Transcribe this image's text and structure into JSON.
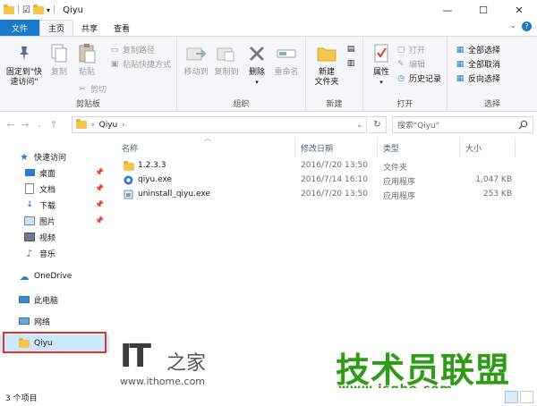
{
  "window": {
    "title": "Qiyu",
    "minimize": "—",
    "maximize": "☐",
    "close": "✕"
  },
  "tabs": [
    {
      "label": "文件"
    },
    {
      "label": "主页"
    },
    {
      "label": "共享"
    },
    {
      "label": "查看"
    }
  ],
  "ribbon": {
    "clipboard": {
      "label": "剪贴板",
      "pin": "固定到\"快\n速访问\"",
      "copy": "复制",
      "paste": "粘贴",
      "copy_path": "复制路径",
      "paste_shortcut": "粘贴快捷方式",
      "cut": "剪切"
    },
    "organize": {
      "label": "组织",
      "move_to": "移动到",
      "copy_to": "复制到",
      "delete": "删除",
      "rename": "重命名"
    },
    "new": {
      "label": "新建",
      "new_folder": "新建\n文件夹"
    },
    "open": {
      "label": "打开",
      "properties": "属性",
      "open": "打开",
      "edit": "编辑",
      "history": "历史记录"
    },
    "select": {
      "label": "选择",
      "select_all": "全部选择",
      "select_none": "全部取消",
      "invert": "反向选择"
    }
  },
  "address": {
    "path": "Qiyu",
    "search_placeholder": "搜索\"Qiyu\""
  },
  "nav": {
    "quick_access": "快速访问",
    "items": [
      {
        "label": "桌面",
        "pinned": true
      },
      {
        "label": "文档",
        "pinned": true
      },
      {
        "label": "下载",
        "pinned": true
      },
      {
        "label": "图片",
        "pinned": true
      },
      {
        "label": "视频",
        "pinned": false
      },
      {
        "label": "音乐",
        "pinned": false
      }
    ],
    "onedrive": "OneDrive",
    "this_pc": "此电脑",
    "network": "网络",
    "selected_folder": "Qiyu"
  },
  "columns": {
    "name": "名称",
    "date": "修改日期",
    "type": "类型",
    "size": "大小"
  },
  "files": [
    {
      "name": "1.2.3.3",
      "date": "2016/7/20 13:50",
      "type": "文件夹",
      "size": "",
      "icon": "folder-icon"
    },
    {
      "name": "qiyu.exe",
      "date": "2016/7/14 16:10",
      "type": "应用程序",
      "size": "1,047 KB",
      "icon": "app-icon"
    },
    {
      "name": "uninstall_qiyu.exe",
      "date": "2016/7/20 13:50",
      "type": "应用程序",
      "size": "253 KB",
      "icon": "uninstall-icon"
    }
  ],
  "status": {
    "count": "3 个项目"
  },
  "watermarks": {
    "it": "IT",
    "home": "之家",
    "ithome_url": "www.ithome.com",
    "jsgho": "技术员联盟",
    "jsgho_url": "www.jsgho.com"
  },
  "colors": {
    "file_tab": "#1979ca",
    "selected_bg": "#cce8ff",
    "highlight_box": "#e0342a",
    "watermark_green": "#2f9b16"
  }
}
